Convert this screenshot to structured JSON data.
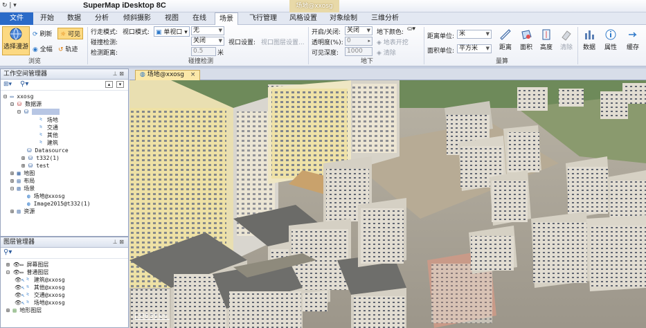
{
  "titlebar": {
    "quick_access": "↻ | ▾",
    "app_title": "SuperMap iDesktop 8C",
    "context_tab": "场地@xxosg"
  },
  "menu": {
    "file": "文件",
    "items": [
      "开始",
      "数据",
      "分析",
      "倾斜摄影",
      "视图",
      "在线",
      "场景",
      "飞行管理",
      "风格设置",
      "对象绘制",
      "三维分析"
    ],
    "active": "场景"
  },
  "ribbon": {
    "browse": {
      "select_roam": "选择漫游",
      "refresh": "刷新",
      "visible": "可见",
      "full": "全幅",
      "track": "轨迹",
      "group": "浏览"
    },
    "collision": {
      "walk_mode": "行走模式:",
      "view_mode": "视口模式:",
      "single_view": "单视口",
      "view_mode_value": "无",
      "collision_detect": "碰撞检测:",
      "collision_detect_value": "关闭",
      "check_distance": "检测距离:",
      "check_distance_value": "0.5",
      "distance_unit": "米",
      "viewport_settings": "视口设置:",
      "viewport_layer_settings": "视口图层设置...",
      "group": "碰撞检测"
    },
    "underground": {
      "open_close": "开启/关闭:",
      "open_close_value": "关闭",
      "transparency": "透明度(%):",
      "transparency_value": "0",
      "visible_depth": "可见深度:",
      "visible_depth_value": "1000",
      "ground_color": "地下颜色:",
      "terrain_dig": "地表开挖",
      "clear": "清除",
      "group": "地下"
    },
    "measure": {
      "distance_unit": "距离单位:",
      "distance_unit_value": "米",
      "area_unit": "面积单位:",
      "area_unit_value": "平方米",
      "distance": "距离",
      "area": "面积",
      "height": "高度",
      "clear": "清除",
      "group": "量算"
    },
    "extra": {
      "data": "数据",
      "attribute": "属性",
      "cache": "缓存"
    }
  },
  "workspace_panel": {
    "title": "工作空间管理器",
    "tree": [
      {
        "label": "xxosg",
        "level": 0
      },
      {
        "label": "数据源",
        "level": 1
      },
      {
        "label": "",
        "level": 2
      },
      {
        "label": "场地",
        "level": 3
      },
      {
        "label": "交通",
        "level": 3
      },
      {
        "label": "其他",
        "level": 3
      },
      {
        "label": "建筑",
        "level": 3
      },
      {
        "label": "Datasource",
        "level": 2
      },
      {
        "label": "t332(1)",
        "level": 2
      },
      {
        "label": "test",
        "level": 2
      },
      {
        "label": "地图",
        "level": 1
      },
      {
        "label": "布局",
        "level": 1
      },
      {
        "label": "场景",
        "level": 1
      },
      {
        "label": "场地@xxosg",
        "level": 2
      },
      {
        "label": "Image2015@t332(1)",
        "level": 2
      },
      {
        "label": "资源",
        "level": 1
      }
    ]
  },
  "layer_panel": {
    "title": "图层管理器",
    "tree": [
      {
        "label": "屏幕图层",
        "level": 0
      },
      {
        "label": "普通图层",
        "level": 0
      },
      {
        "label": "建筑@xxosg",
        "level": 1
      },
      {
        "label": "其他@xxosg",
        "level": 1
      },
      {
        "label": "交通@xxosg",
        "level": 1
      },
      {
        "label": "场地@xxosg",
        "level": 1
      },
      {
        "label": "地形图层",
        "level": 0
      }
    ]
  },
  "document": {
    "tab_label": "场地@xxosg",
    "scale_label": "336.59 km"
  },
  "colors": {
    "accent": "#2a6ac8",
    "tab_active": "#fbe8a8",
    "toggle_on": "#fcd982"
  }
}
